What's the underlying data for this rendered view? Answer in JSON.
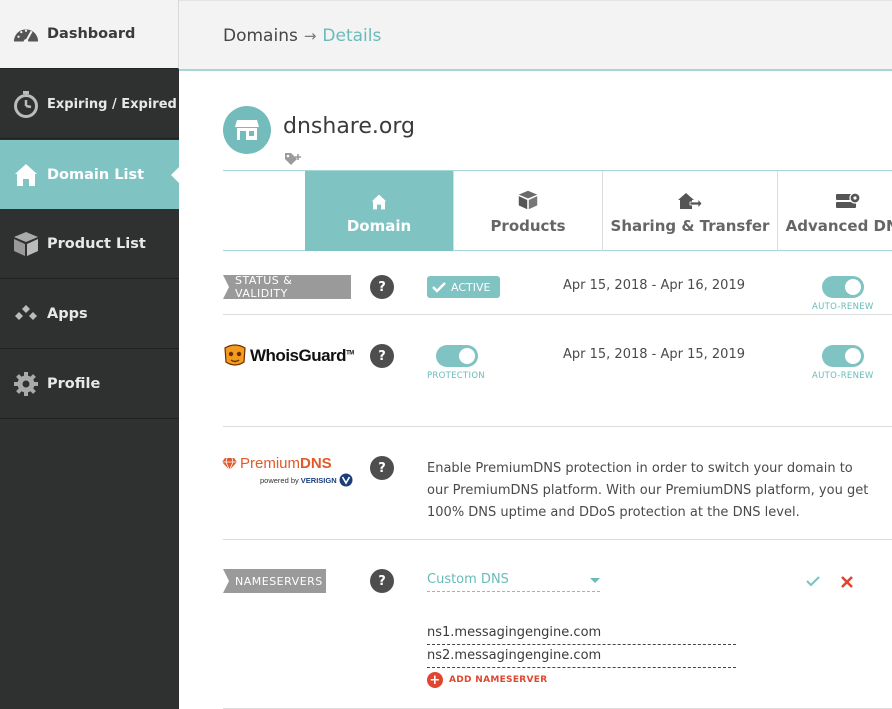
{
  "sidebar": {
    "items": [
      {
        "label": "Dashboard",
        "icon": "speedometer-icon"
      },
      {
        "label": "Expiring / Expired",
        "icon": "stopwatch-icon"
      },
      {
        "label": "Domain List",
        "icon": "home-icon"
      },
      {
        "label": "Product List",
        "icon": "box-icon"
      },
      {
        "label": "Apps",
        "icon": "apps-icon"
      },
      {
        "label": "Profile",
        "icon": "gear-icon"
      }
    ]
  },
  "breadcrumb": {
    "root": "Domains",
    "separator": "→",
    "current": "Details"
  },
  "domain": {
    "name": "dnshare.org",
    "icon": "storefront-icon"
  },
  "tabs": [
    {
      "label": "Domain",
      "icon": "home-icon"
    },
    {
      "label": "Products",
      "icon": "box-icon"
    },
    {
      "label": "Sharing & Transfer",
      "icon": "house-transfer-icon"
    },
    {
      "label": "Advanced DNS",
      "icon": "server-gear-icon"
    }
  ],
  "status": {
    "label": "STATUS & VALIDITY",
    "help": "?",
    "badge": "ACTIVE",
    "dates": "Apr 15, 2018 - Apr 16, 2019",
    "autorenew_label": "AUTO-RENEW",
    "autorenew_on": true
  },
  "whoisguard": {
    "logo_text": "WhoisGuard",
    "logo_tm": "TM",
    "help": "?",
    "protection_label": "PROTECTION",
    "protection_on": true,
    "dates": "Apr 15, 2018 - Apr 15, 2019",
    "autorenew_label": "AUTO-RENEW",
    "autorenew_on": true
  },
  "premiumdns": {
    "logo_main": "Premium",
    "logo_bold": "DNS",
    "logo_sub": "powered by",
    "logo_sub_brand": "VERISIGN",
    "help": "?",
    "description": "Enable PremiumDNS protection in order to switch your domain to our PremiumDNS platform. With our PremiumDNS platform, you get 100% DNS uptime and DDoS protection at the DNS level."
  },
  "nameservers": {
    "label": "NAMESERVERS",
    "help": "?",
    "selected": "Custom DNS",
    "entries": [
      "ns1.messagingengine.com",
      "ns2.messagingengine.com"
    ],
    "add_label": "ADD NAMESERVER"
  },
  "colors": {
    "accent": "#7fc3c3",
    "sidebar": "#2f3131",
    "danger": "#e0462f"
  }
}
